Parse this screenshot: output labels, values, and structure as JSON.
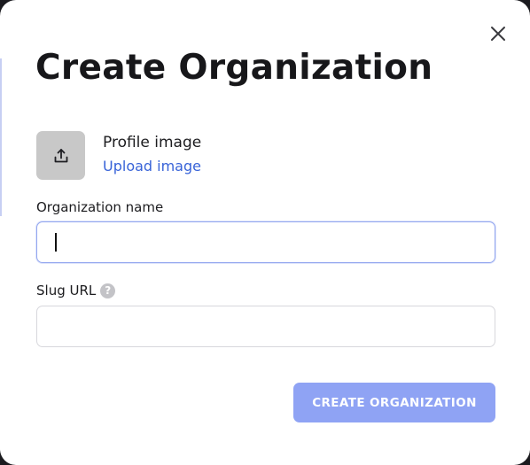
{
  "dialog": {
    "title": "Create Organization",
    "close_icon": "close-icon"
  },
  "profile": {
    "label": "Profile image",
    "upload_link": "Upload image",
    "icon": "upload-icon"
  },
  "fields": {
    "org_name": {
      "label": "Organization name",
      "value": "",
      "placeholder": ""
    },
    "slug": {
      "label": "Slug URL",
      "help_icon": "help-icon",
      "help_glyph": "?",
      "value": "",
      "placeholder": ""
    }
  },
  "actions": {
    "submit_label": "CREATE ORGANIZATION"
  },
  "colors": {
    "accent": "#8fa3f4",
    "link": "#3863d8",
    "focus_border": "#93a6ef"
  }
}
